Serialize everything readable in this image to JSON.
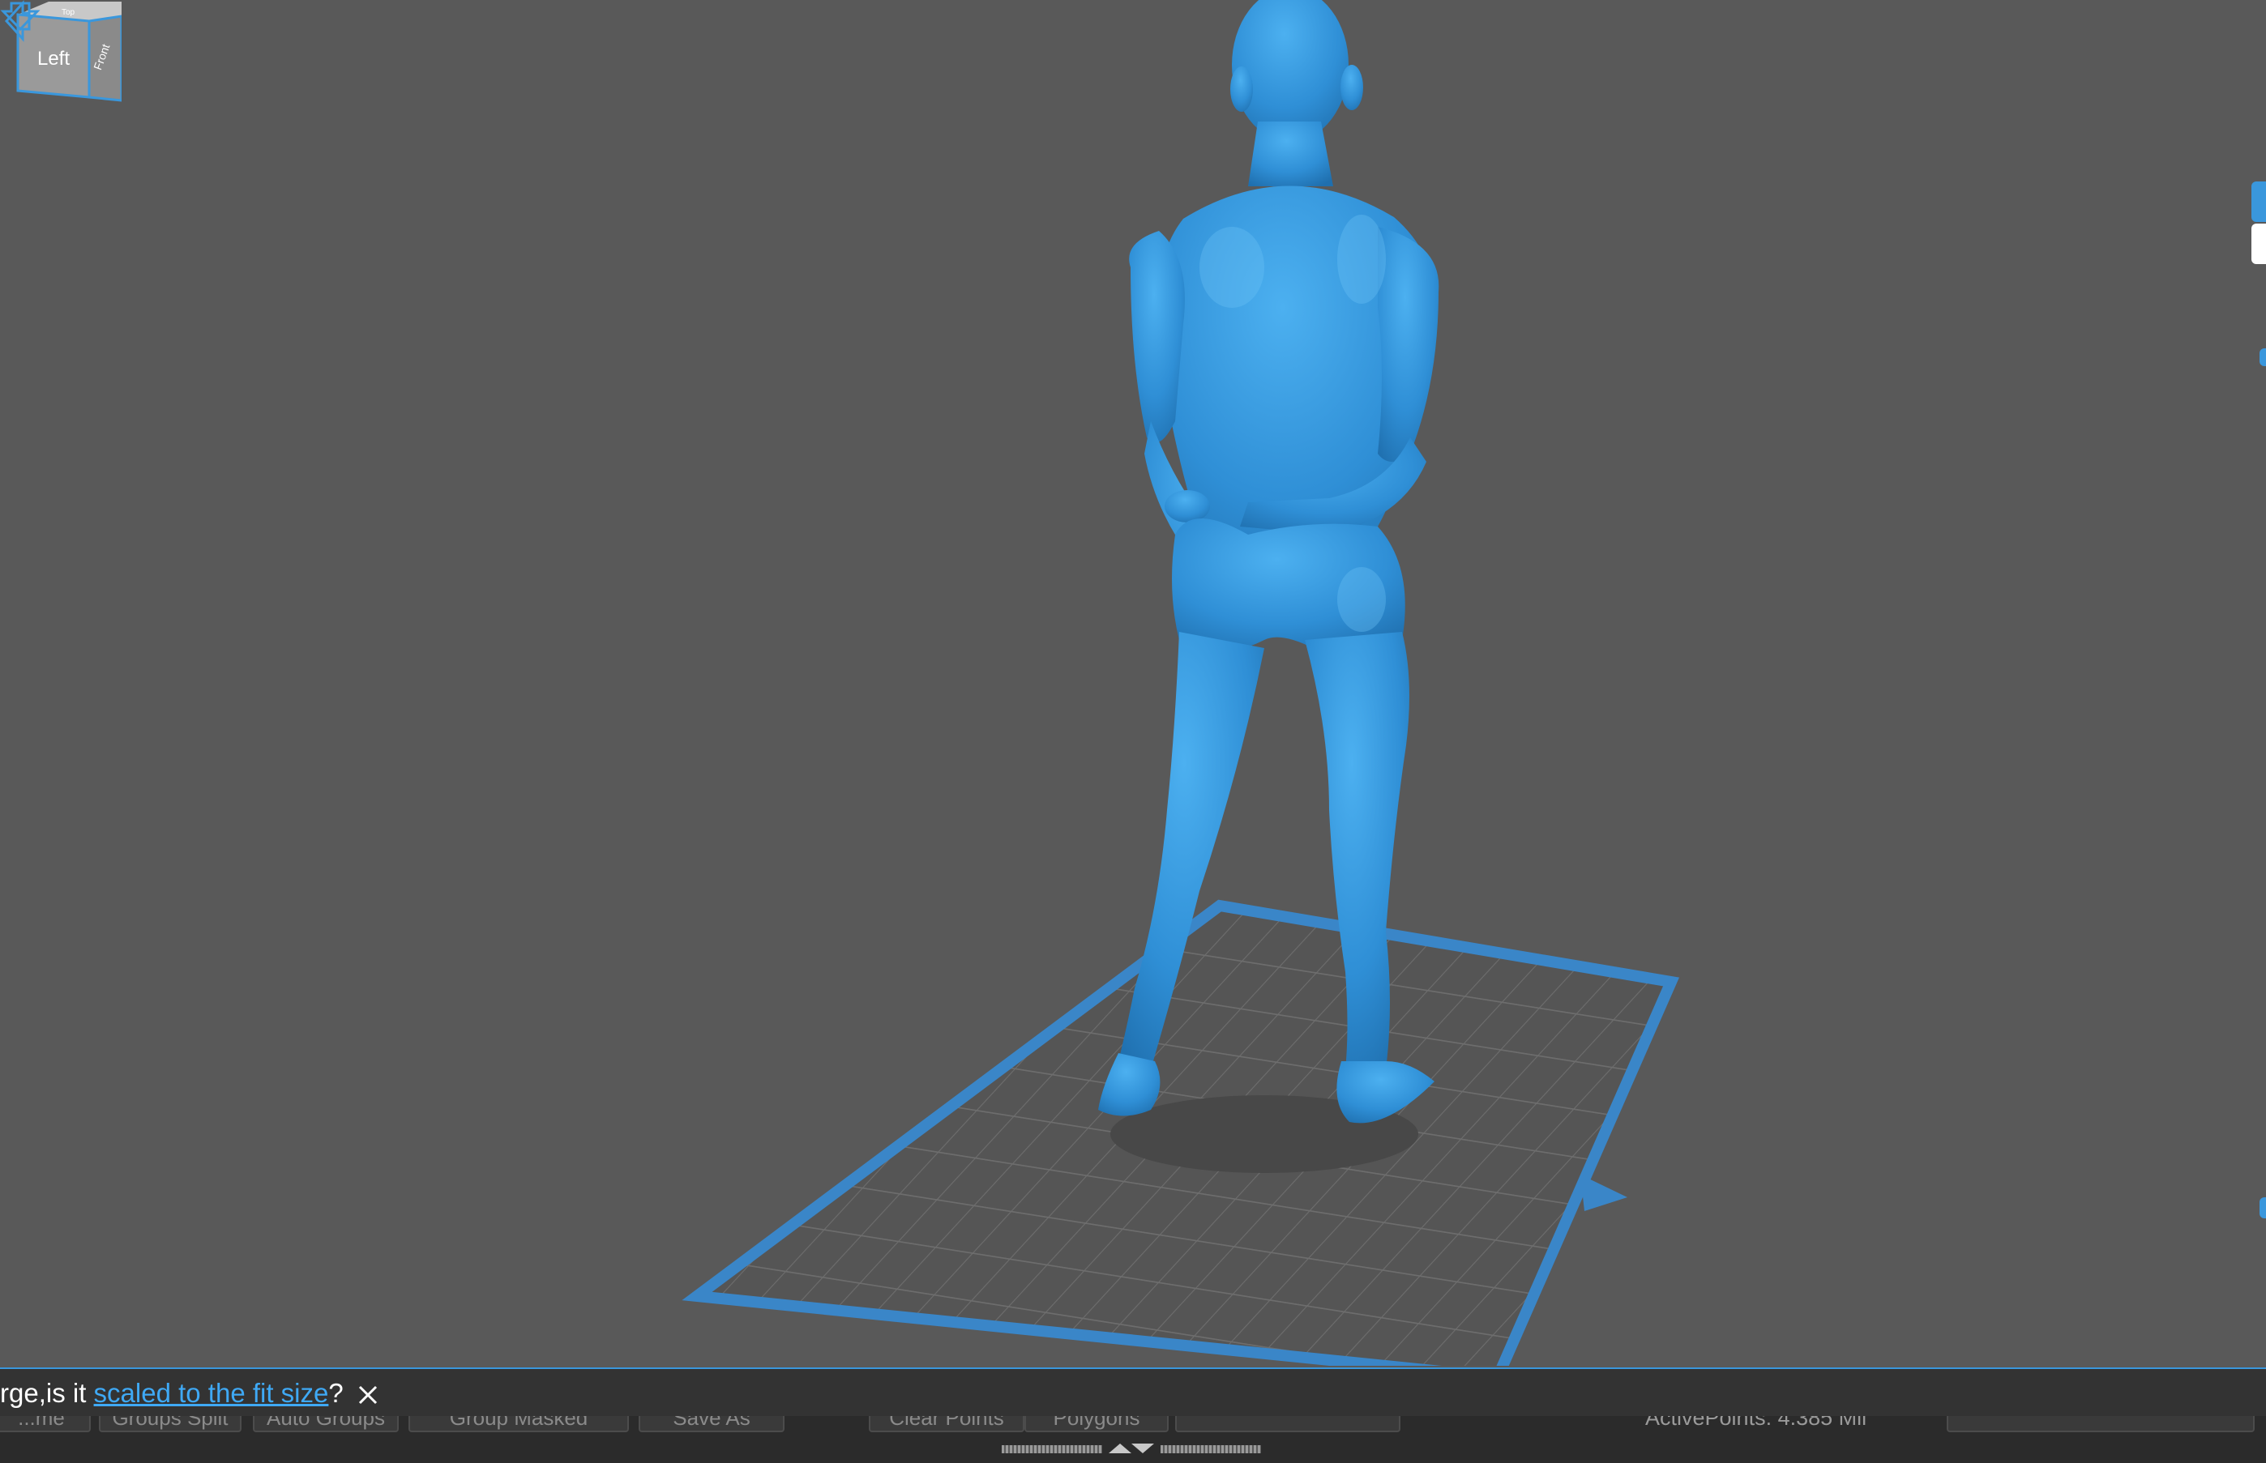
{
  "notification": {
    "prefix": "rge,is it ",
    "link": "scaled to the fit size",
    "suffix": "?"
  },
  "view_cube": {
    "left_face": "Left",
    "front_face": "Front",
    "top_face": "Top"
  },
  "toolbar": {
    "buttons": [
      {
        "id": "btn-0",
        "label": "...me"
      },
      {
        "id": "btn-1",
        "label": "Groups Split"
      },
      {
        "id": "btn-2",
        "label": "Auto Groups"
      },
      {
        "id": "btn-3",
        "label": "Group Masked"
      },
      {
        "id": "btn-4",
        "label": "Save As"
      },
      {
        "id": "btn-5",
        "label": "Clear Points"
      },
      {
        "id": "btn-6",
        "label": "Polygons"
      },
      {
        "id": "btn-7",
        "label": ""
      }
    ],
    "active_points": "ActivePoints: 4.385 Mil"
  },
  "colors": {
    "background": "#595959",
    "model": "#3a97dc",
    "accent": "#3a97dc",
    "bar": "#333333"
  },
  "icons": {
    "close": "close-icon",
    "arrow_left": "rotate-left-icon",
    "arrow_down": "rotate-down-icon",
    "handle": "collapse-toggle-icon"
  }
}
